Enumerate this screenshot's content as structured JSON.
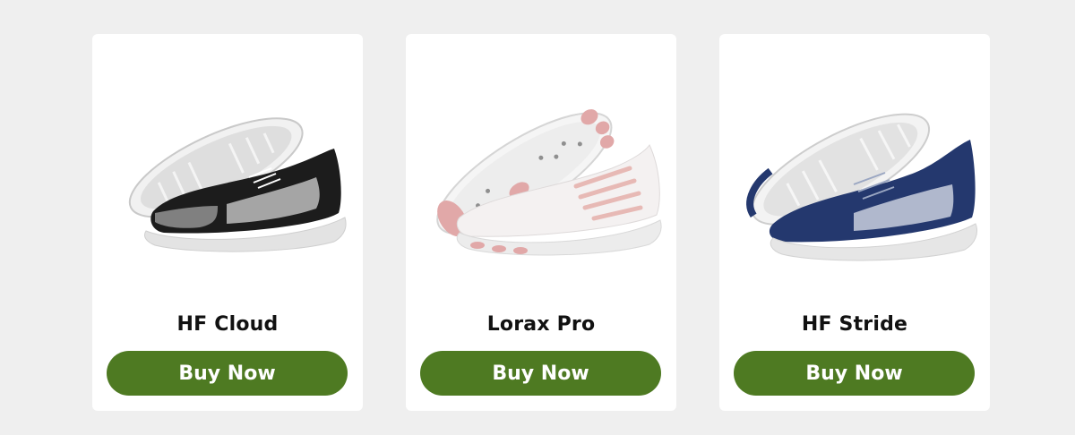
{
  "products": [
    {
      "name": "HF Cloud",
      "button_label": "Buy Now",
      "colors": {
        "upper": "#1c1c1c",
        "mesh": "#bdbdbd",
        "sole": "#e3e3e3",
        "accent": "#9a9a9a"
      }
    },
    {
      "name": "Lorax Pro",
      "button_label": "Buy Now",
      "colors": {
        "upper": "#f4f1f1",
        "mesh": "#e7b9b5",
        "sole": "#ececec",
        "accent": "#e1a8a8"
      }
    },
    {
      "name": "HF Stride",
      "button_label": "Buy Now",
      "colors": {
        "upper": "#24386e",
        "mesh": "#dfe3ee",
        "sole": "#e6e6e6",
        "accent": "#9aa6c2"
      }
    }
  ],
  "theme": {
    "page_background": "#efefef",
    "card_background": "#ffffff",
    "button_color": "#4e7a22",
    "button_text_color": "#ffffff"
  }
}
